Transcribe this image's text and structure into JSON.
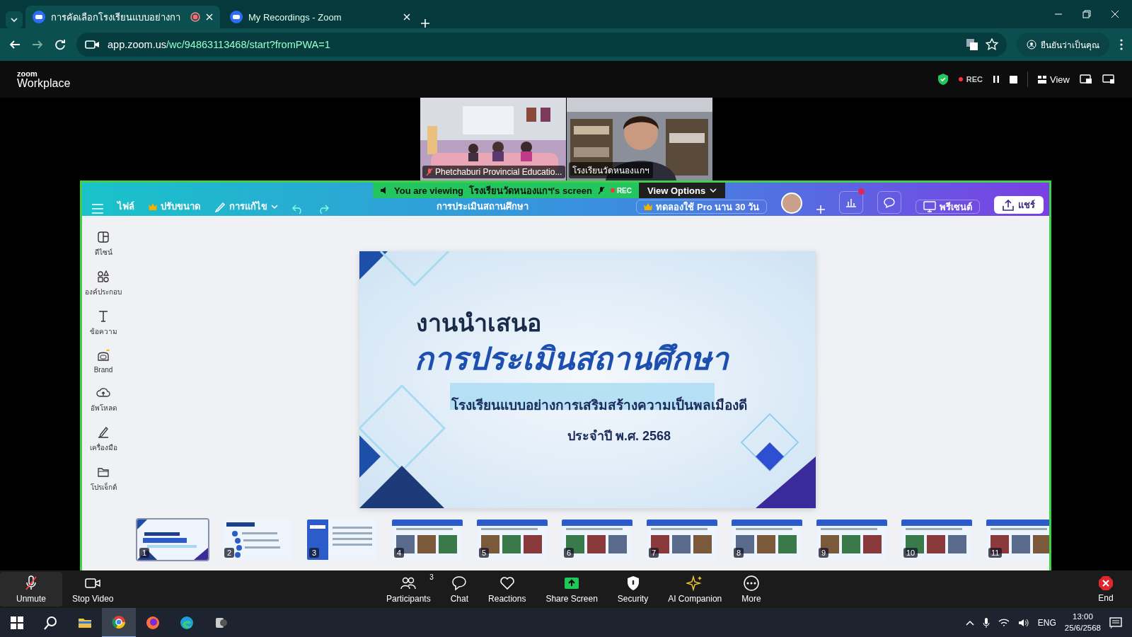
{
  "browser": {
    "tabs": [
      {
        "title": "การคัดเลือกโรงเรียนแบบอย่างกา",
        "selected": true,
        "recording": true
      },
      {
        "title": "My Recordings - Zoom",
        "selected": false,
        "recording": false
      }
    ],
    "url_host": "app.zoom.us",
    "url_path": "/wc/94863113468/start?fromPWA=1",
    "profile": "ยืนยันว่าเป็นคุณ"
  },
  "meeting_header": {
    "brand_top": "zoom",
    "brand_bottom": "Workplace",
    "rec": "REC",
    "view": "View"
  },
  "videos": [
    {
      "name": "Phetchaburi Provincial Educatio...",
      "muted": true
    },
    {
      "name": "โรงเรียนวัดหนองแกฯ",
      "muted": false
    }
  ],
  "share_banner": {
    "prefix": "You are viewing",
    "screen": "โรงเรียนวัดหนองแกฯ's screen",
    "rec": "REC",
    "options": "View Options"
  },
  "canva": {
    "file": "ไฟล์",
    "resize": "ปรับขนาด",
    "edit": "การแก้ไข",
    "title": "การประเมินสถานศึกษา",
    "pro": "ทดลองใช้ Pro นาน 30 วัน",
    "present": "พรีเซนต์",
    "share": "แชร์",
    "sidebar": [
      {
        "kind": "design",
        "label": "ดีไซน์"
      },
      {
        "kind": "elements",
        "label": "องค์ประกอบ"
      },
      {
        "kind": "text",
        "label": "ข้อความ"
      },
      {
        "kind": "brand",
        "label": "Brand"
      },
      {
        "kind": "upload",
        "label": "อัพโหลด"
      },
      {
        "kind": "tools",
        "label": "เครื่องมือ"
      },
      {
        "kind": "projects",
        "label": "โปรเจ็กต์"
      }
    ],
    "slide": {
      "kicker": "งานนำเสนอ",
      "title": "การประเมินสถานศึกษา",
      "subtitle": "โรงเรียนแบบอย่างการเสริมสร้างความเป็นพลเมืองดี",
      "year": "ประจำปี พ.ศ. 2568"
    },
    "thumbnails": [
      {
        "number": "1",
        "selected": true
      },
      {
        "number": "2",
        "selected": false
      },
      {
        "number": "3",
        "selected": false
      },
      {
        "number": "4",
        "selected": false
      },
      {
        "number": "5",
        "selected": false
      },
      {
        "number": "6",
        "selected": false
      },
      {
        "number": "7",
        "selected": false
      },
      {
        "number": "8",
        "selected": false
      },
      {
        "number": "9",
        "selected": false
      },
      {
        "number": "10",
        "selected": false
      },
      {
        "number": "11",
        "selected": false
      }
    ]
  },
  "meeting_toolbar": {
    "left": [
      {
        "kind": "mic",
        "label": "Unmute",
        "muted": true
      },
      {
        "kind": "camera",
        "label": "Stop Video"
      }
    ],
    "center": [
      {
        "kind": "participants",
        "label": "Participants",
        "count": "3"
      },
      {
        "kind": "chat",
        "label": "Chat"
      },
      {
        "kind": "reactions",
        "label": "Reactions"
      },
      {
        "kind": "share",
        "label": "Share Screen"
      },
      {
        "kind": "security",
        "label": "Security"
      },
      {
        "kind": "ai",
        "label": "AI Companion"
      },
      {
        "kind": "more",
        "label": "More"
      }
    ],
    "end": "End"
  },
  "taskbar": {
    "language": "ENG",
    "time": "13:00",
    "date": "25/6/2568"
  }
}
